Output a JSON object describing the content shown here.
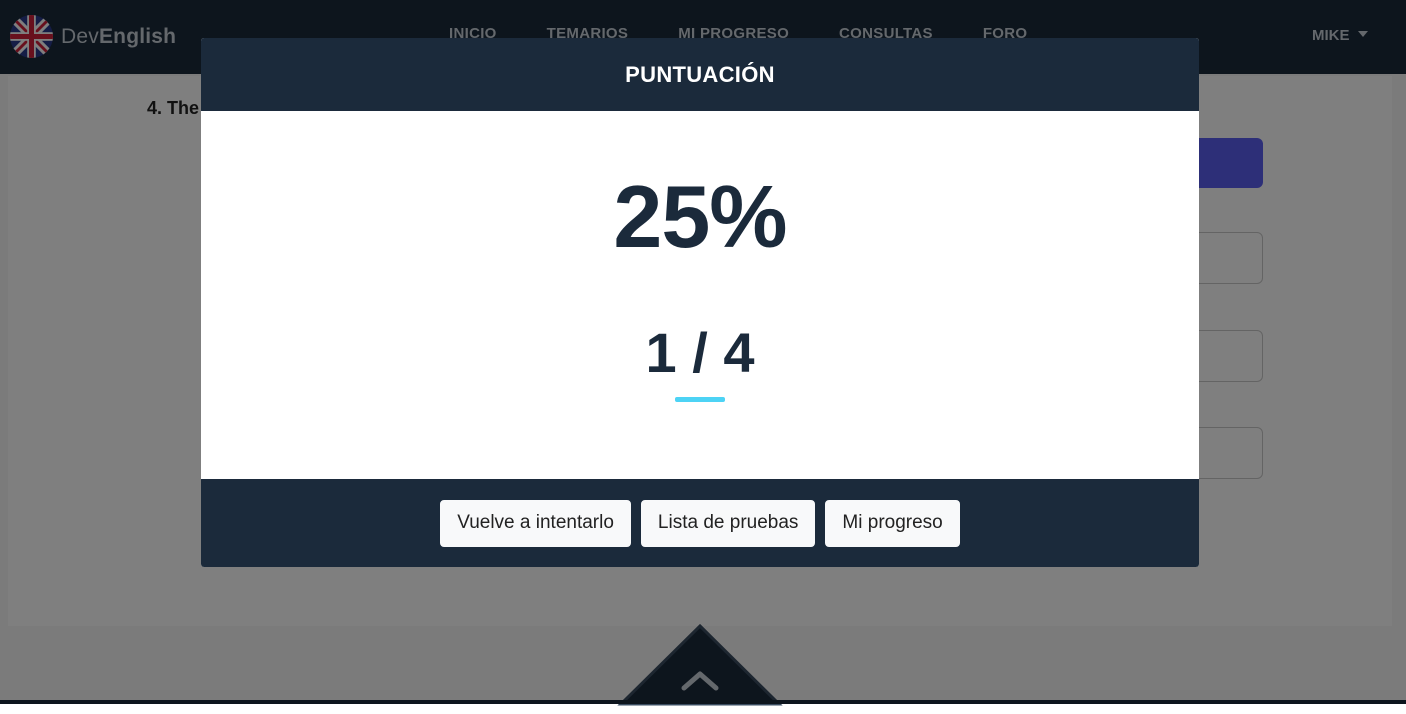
{
  "navbar": {
    "logo_prefix": "Dev",
    "logo_suffix": "English",
    "links": [
      "INICIO",
      "TEMARIOS",
      "MI PROGRESO",
      "CONSULTAS",
      "FORO"
    ],
    "user_label": "MIKE"
  },
  "page": {
    "question_title": "4. The"
  },
  "modal": {
    "title": "PUNTUACIÓN",
    "score_percent": "25%",
    "score_fraction": "1 / 4",
    "buttons": {
      "retry": "Vuelve a intentarlo",
      "tests_list": "Lista de pruebas",
      "my_progress": "Mi progreso"
    }
  },
  "colors": {
    "navy": "#1b2a3b",
    "accent_cyan": "#4dd3f5",
    "primary_button": "#5a5ef0"
  },
  "icons": {
    "logo": "uk-flag-icon",
    "scroll_top": "chevron-up-icon",
    "user_menu": "caret-down-icon"
  }
}
